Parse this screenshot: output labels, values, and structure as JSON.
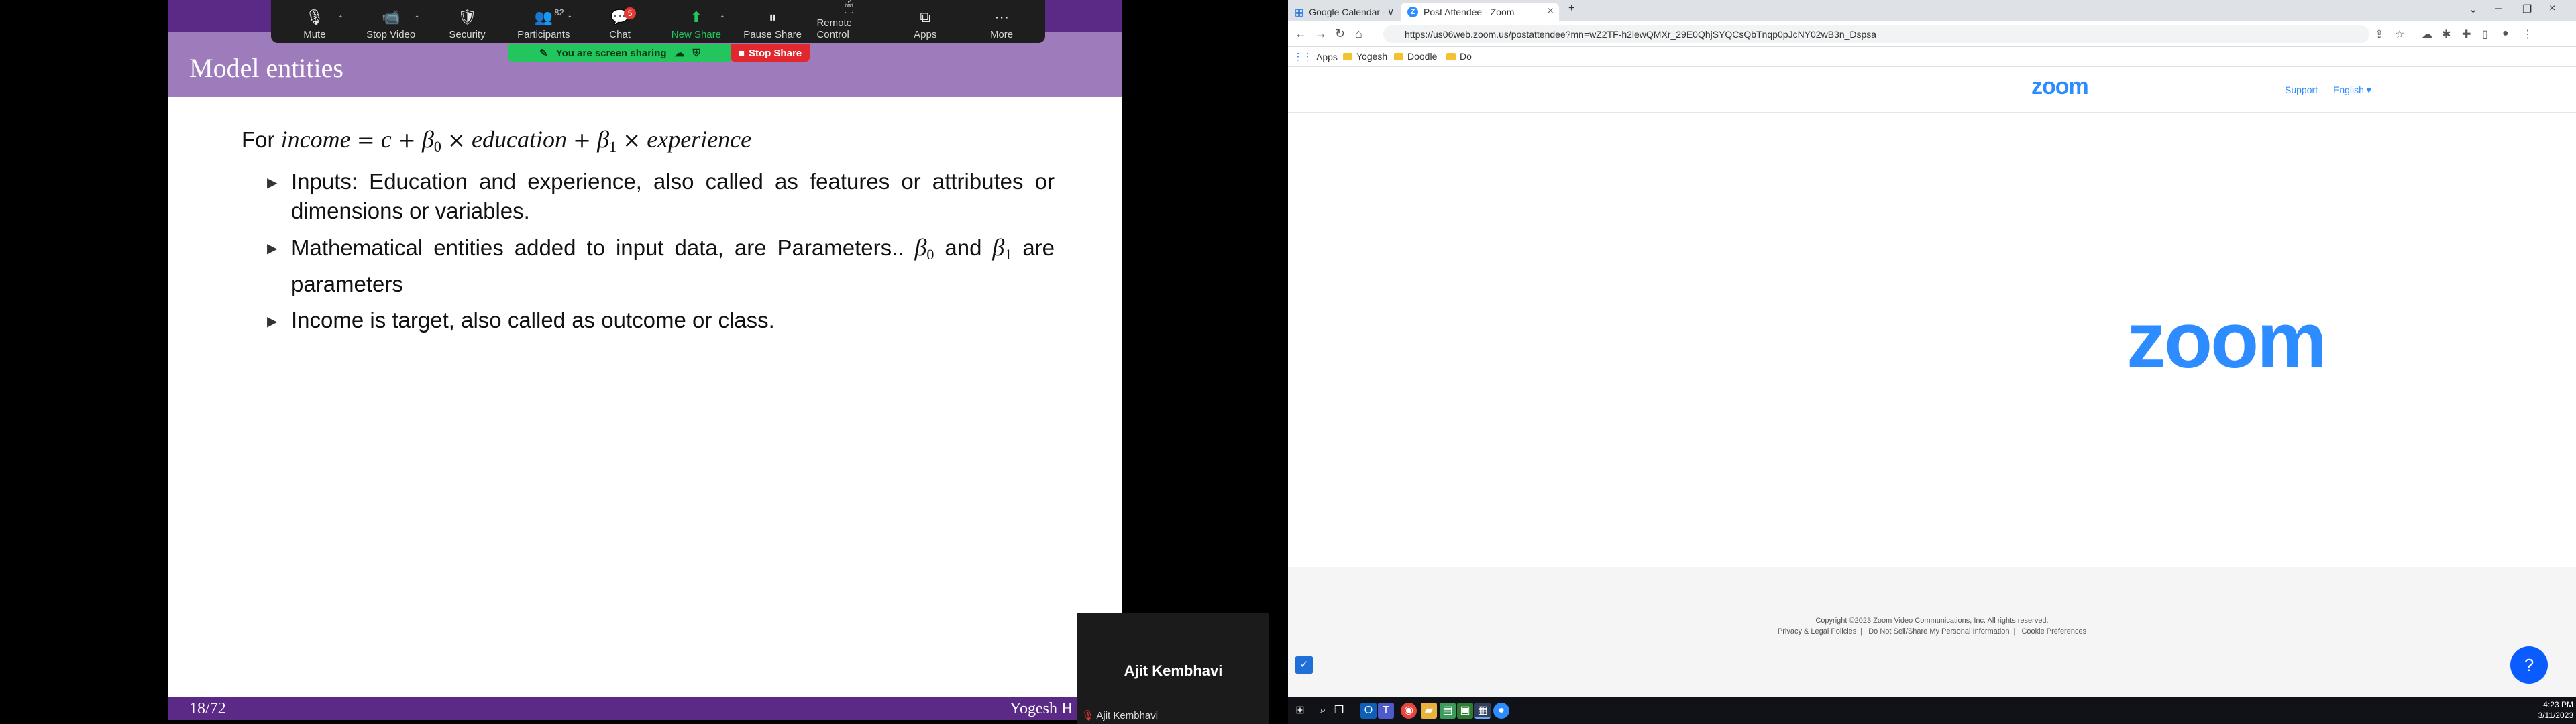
{
  "zoom_toolbar": {
    "items": [
      {
        "label": "Mute",
        "icon": "🎙"
      },
      {
        "label": "Stop Video",
        "icon": "📹"
      },
      {
        "label": "Security",
        "icon": "🛡"
      },
      {
        "label": "Participants",
        "icon": "👥",
        "count": "82"
      },
      {
        "label": "Chat",
        "icon": "💬",
        "badge": "5"
      },
      {
        "label": "New Share",
        "icon": "⬆"
      },
      {
        "label": "Pause Share",
        "icon": "⏸"
      },
      {
        "label": "Remote Control",
        "icon": "🖱"
      },
      {
        "label": "Apps",
        "icon": "⧉"
      },
      {
        "label": "More",
        "icon": "⋯"
      }
    ],
    "sharing_text": "You are screen sharing",
    "stop_share": "Stop Share"
  },
  "slide": {
    "title": "Model entities",
    "formula": {
      "lead": "For",
      "income": "income",
      "eq": "=",
      "c": "c",
      "plus": "+",
      "beta": "β",
      "sub0": "0",
      "sub1": "1",
      "times": "×",
      "education": "education",
      "experience": "experience"
    },
    "bullets": [
      {
        "text": "Inputs: Education and experience, also called as features or attributes or dimensions or variables."
      },
      {
        "pre": "Mathematical entities added to input data, are Parameters..",
        "and": "and",
        "post": "are parameters"
      },
      {
        "text": "Income is target, also called as outcome or class."
      }
    ],
    "page": "18/72",
    "author": "Yogesh H Kulkar"
  },
  "video_tile": {
    "name": "Ajit Kembhavi",
    "label": "Ajit Kembhavi"
  },
  "browser": {
    "tabs": [
      {
        "title": "Google Calendar - Week of Ma...",
        "icon": "▦"
      },
      {
        "title": "Post Attendee - Zoom",
        "icon": "Z"
      }
    ],
    "new_tab": "+",
    "url": "https://us06web.zoom.us/postattendee?mn=wZ2TF-h2lewQMXr_29E0QhjSYQCsQbTnqp0pJcNY02wB3n_Dspsa",
    "bookmarks": [
      "Apps",
      "Yogesh",
      "Doodle",
      "Do"
    ],
    "accent": "#2d8cff"
  },
  "zoom_page": {
    "logo_small": "zoom",
    "support": "Support",
    "language": "English ▾",
    "logo_large": "zoom",
    "copyright": "Copyright ©2023 Zoom Video Communications, Inc. All rights reserved.",
    "footer_links": [
      "Privacy & Legal Policies",
      "Do Not Sell/Share My Personal Information",
      "Cookie Preferences"
    ]
  },
  "taskbar": {
    "time": "4:23 PM",
    "date": "3/11/2023"
  }
}
